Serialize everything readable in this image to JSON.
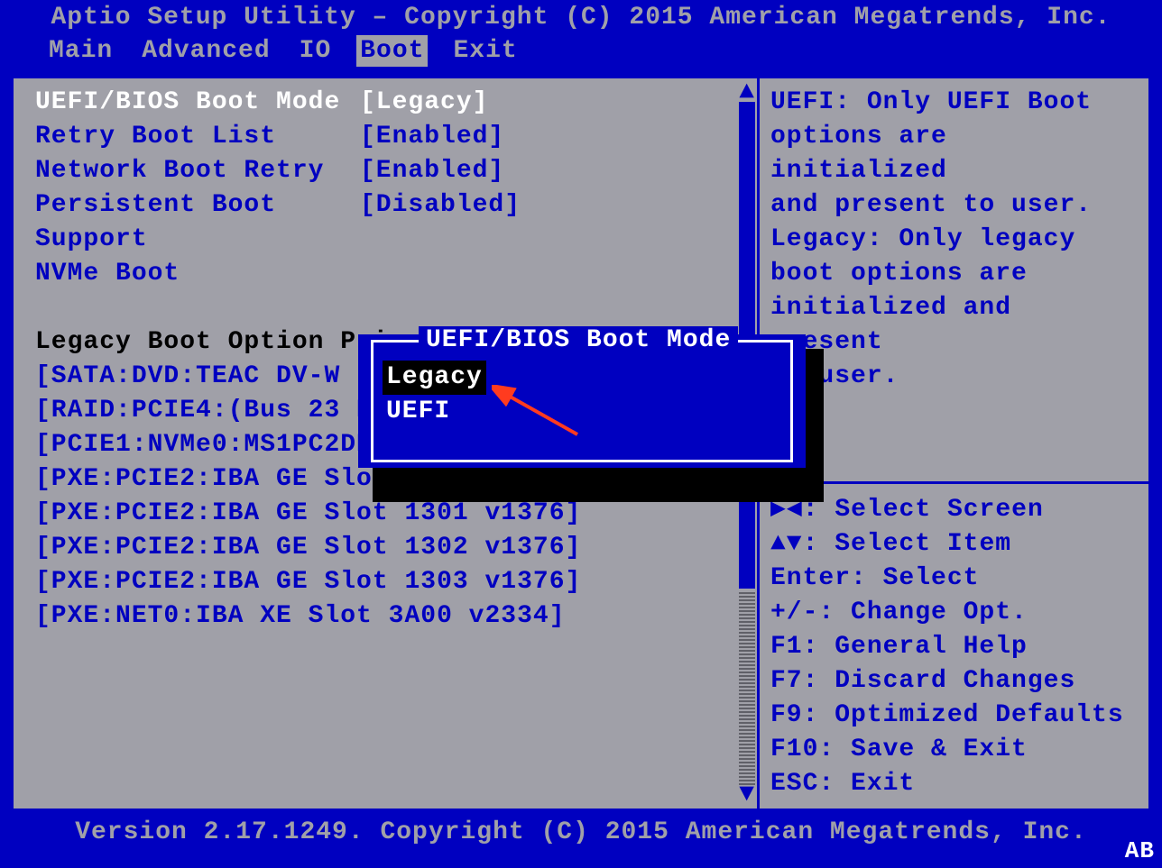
{
  "title": "Aptio Setup Utility – Copyright (C) 2015 American Megatrends, Inc.",
  "menu": [
    "Main",
    "Advanced",
    "IO",
    "Boot",
    "Exit"
  ],
  "activeMenuIndex": 3,
  "settings": [
    {
      "label": "UEFI/BIOS Boot Mode",
      "value": "[Legacy]",
      "selected": true
    },
    {
      "label": "Retry Boot List",
      "value": "[Enabled]"
    },
    {
      "label": "Network Boot Retry",
      "value": "[Enabled]"
    },
    {
      "label": "",
      "value": ""
    },
    {
      "label": "Persistent Boot",
      "value": "[Disabled]"
    },
    {
      "label": "Support",
      "value": ""
    },
    {
      "label": "",
      "value": ""
    },
    {
      "label": "NVMe Boot",
      "value": ""
    }
  ],
  "sectionHeader": "Legacy Boot Option Pri",
  "bootEntries": [
    "[SATA:DVD:TEAC   DV-W",
    "[RAID:PCIE4:(Bus 23 Dev",
    "[PCIE1:NVMe0:MS1PC2DD3ORA3.2T ]",
    "[PXE:PCIE2:IBA GE Slot 1300 v1376]",
    "[PXE:PCIE2:IBA GE Slot 1301 v1376]",
    "[PXE:PCIE2:IBA GE Slot 1302 v1376]",
    "[PXE:PCIE2:IBA GE Slot 1303 v1376]",
    "[PXE:NET0:IBA XE Slot 3A00 v2334]"
  ],
  "helpText": [
    "UEFI: Only UEFI Boot",
    "options are initialized",
    "and present to user.",
    "Legacy: Only legacy",
    "boot options are",
    "initialized and present",
    "to user."
  ],
  "navHelp": [
    "><: Select Screen",
    "^v: Select Item",
    "Enter: Select",
    "+/-: Change Opt.",
    "F1: General Help",
    "F7: Discard Changes",
    "F9: Optimized Defaults",
    "F10: Save & Exit",
    "ESC: Exit"
  ],
  "navArrows": {
    "selectScreen": "Select Screen",
    "selectItem": "Select Item"
  },
  "popup": {
    "title": "UEFI/BIOS Boot Mode",
    "options": [
      "Legacy",
      "UEFI"
    ],
    "selectedIndex": 0
  },
  "footer": "Version 2.17.1249. Copyright (C) 2015 American Megatrends, Inc.",
  "cornerLabel": "AB"
}
